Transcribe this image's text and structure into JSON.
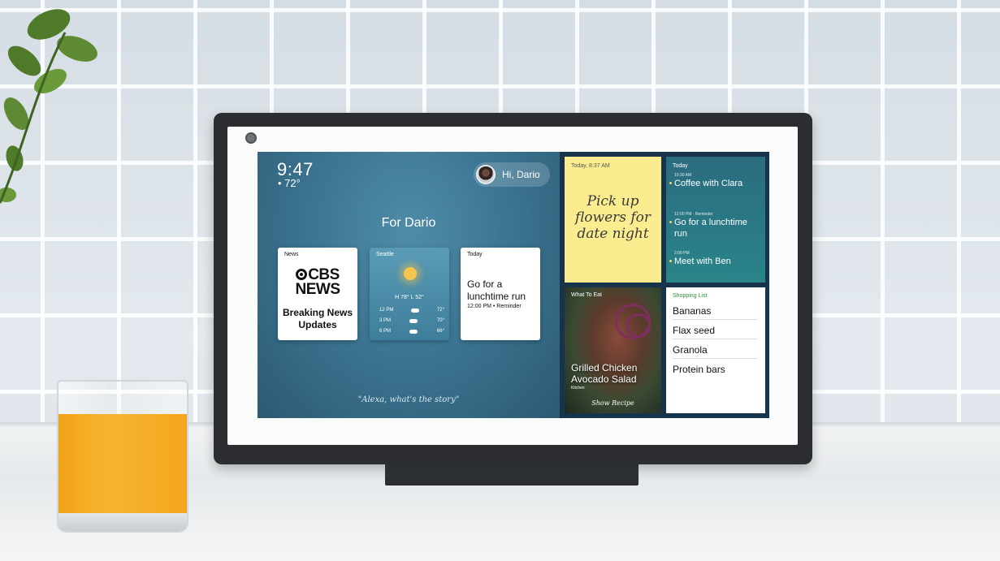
{
  "clock": {
    "time": "9:47",
    "temp": "• 72°"
  },
  "greeting": {
    "text": "Hi, Dario"
  },
  "home": {
    "title": "For Dario",
    "hint": "\"Alexa, what's the story\""
  },
  "cards": {
    "news": {
      "label": "News",
      "logo": "CBS",
      "logo2": "NEWS",
      "headline": "Breaking News Updates"
    },
    "weather": {
      "label": "Seattle",
      "hilo": "H 78° L 52°",
      "forecast": [
        {
          "time": "12 PM",
          "temp": "72°"
        },
        {
          "time": "3 PM",
          "temp": "70°"
        },
        {
          "time": "6 PM",
          "temp": "66°"
        }
      ]
    },
    "today": {
      "label": "Today",
      "title": "Go for a lunchtime run",
      "subtitle": "12:00 PM • Reminder"
    }
  },
  "sticky": {
    "time": "Today, 8:37 AM",
    "text": "Pick up flowers for date night"
  },
  "agenda": {
    "label": "Today",
    "items": [
      {
        "time": "10:30 AM",
        "title": "Coffee with Clara"
      },
      {
        "time": "12:00 PM · Reminder",
        "title": "Go for a lunchtime run"
      },
      {
        "time": "2:00 PM",
        "title": "Meet with Ben"
      }
    ]
  },
  "recipe": {
    "label": "What To Eat",
    "title": "Grilled Chicken Avocado Salad",
    "source": "Kitchen",
    "button": "Show Recipe"
  },
  "shopping": {
    "label": "Shopping List",
    "items": [
      "Bananas",
      "Flax seed",
      "Granola",
      "Protein bars"
    ]
  },
  "colors": {
    "sticky": "#fbed8f",
    "juice": "#f4a51d",
    "device": "#2b2d30",
    "screen_bg": "#3c7592"
  }
}
